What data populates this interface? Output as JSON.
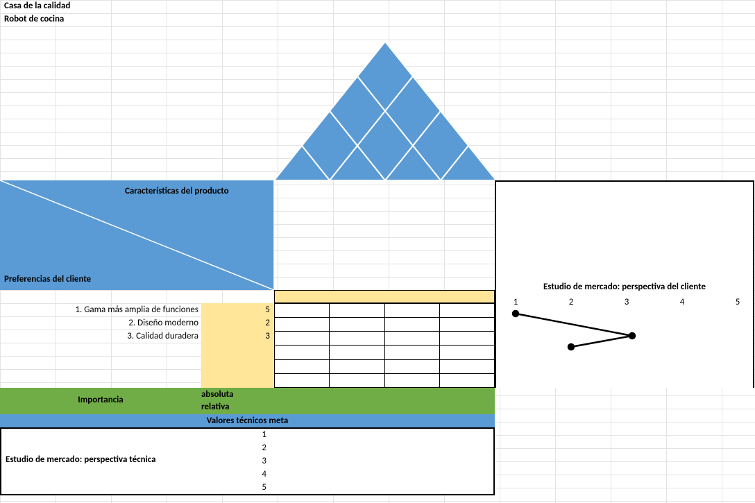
{
  "header": {
    "title": "Casa de la calidad",
    "subtitle": "Robot de cocina"
  },
  "labels": {
    "product_characteristics": "Características del producto",
    "client_preferences": "Preferencias del cliente",
    "importance": "Importancia",
    "importance_absolute": "absoluta",
    "importance_relative": "relativa",
    "technical_targets": "Valores técnicos meta",
    "technical_study": "Estudio de mercado: perspectiva técnica",
    "client_study": "Estudio de mercado: perspectiva del cliente"
  },
  "preferences": [
    {
      "label": "1. Gama más amplia de funciones",
      "weight": 5
    },
    {
      "label": "2. Diseño moderno",
      "weight": 2
    },
    {
      "label": "3. Calidad duradera",
      "weight": 3
    }
  ],
  "technical_study_rows": [
    "1",
    "2",
    "3",
    "4",
    "5"
  ],
  "client_study_axis": [
    "1",
    "2",
    "3",
    "4",
    "5"
  ],
  "chart_data": {
    "type": "line",
    "xlabel": "",
    "ylabel": "",
    "xlim": [
      1,
      5
    ],
    "series": [
      {
        "name": "client-perspective",
        "points": [
          {
            "x": 1.0,
            "y_ref_row": 0
          },
          {
            "x": 3.1,
            "y_ref_row": 1
          },
          {
            "x": 2.0,
            "y_ref_row": 2
          }
        ]
      }
    ]
  },
  "colors": {
    "blue": "#5b9bd5",
    "green": "#70ad47",
    "yellow": "#ffe699"
  }
}
